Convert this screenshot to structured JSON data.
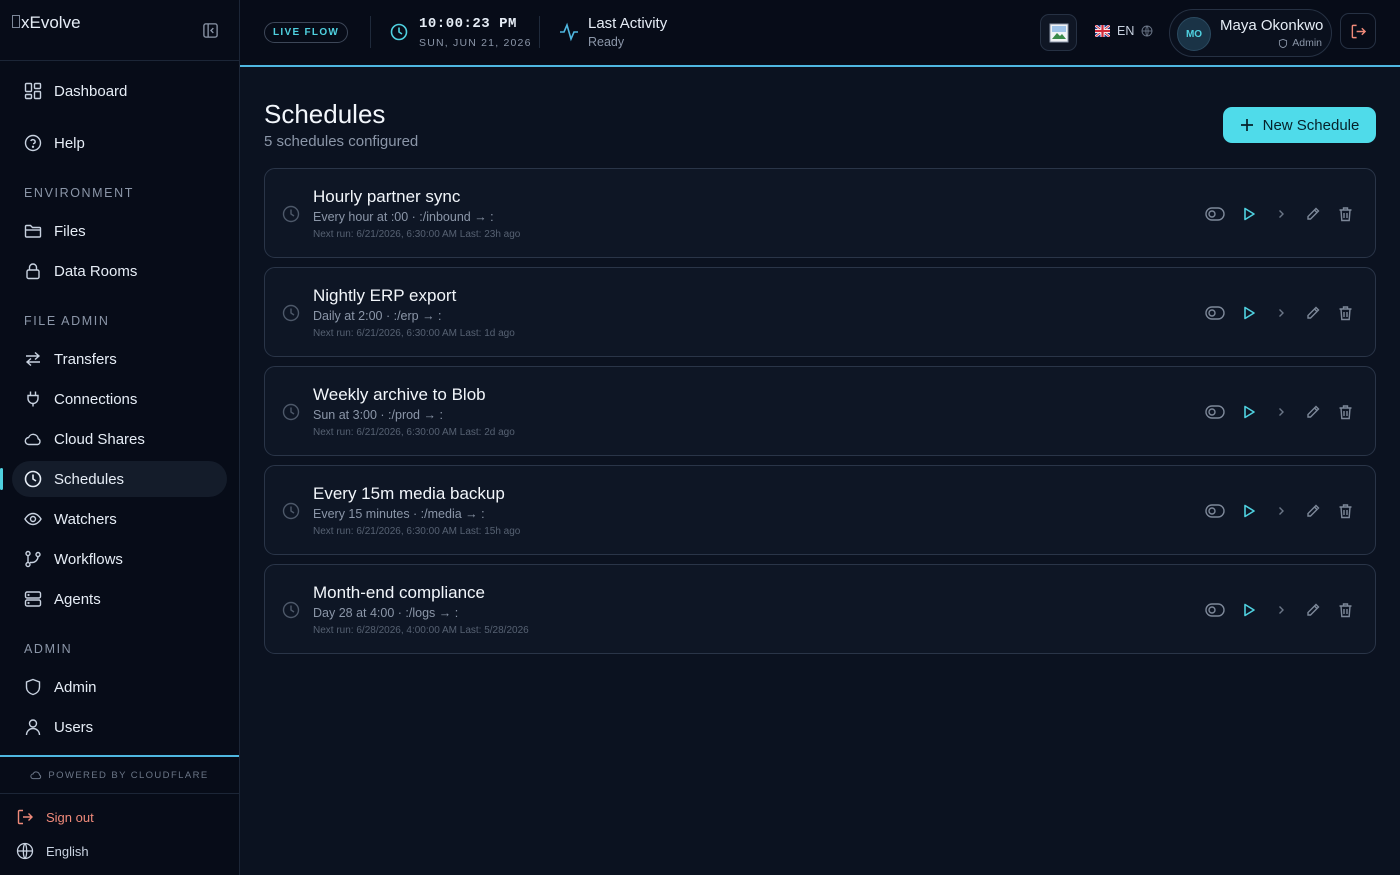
{
  "app": {
    "logo_text": "xEvolve"
  },
  "sidebar": {
    "items": [
      {
        "label": "Dashboard",
        "icon": "dashboard-icon"
      },
      {
        "label": "Help",
        "icon": "help-icon"
      },
      {
        "label": "Files",
        "icon": "folder-icon"
      },
      {
        "label": "Data Rooms",
        "icon": "lock-icon"
      },
      {
        "label": "Transfers",
        "icon": "transfer-arrows-icon"
      },
      {
        "label": "Connections",
        "icon": "plug-icon"
      },
      {
        "label": "Cloud Shares",
        "icon": "cloud-icon"
      },
      {
        "label": "Schedules",
        "icon": "clock-icon",
        "active": true
      },
      {
        "label": "Watchers",
        "icon": "eye-icon"
      },
      {
        "label": "Workflows",
        "icon": "git-branch-icon"
      },
      {
        "label": "Agents",
        "icon": "server-icon"
      },
      {
        "label": "Admin",
        "icon": "shield-icon"
      },
      {
        "label": "Users",
        "icon": "user-icon"
      }
    ],
    "sections": {
      "environment": "ENVIRONMENT",
      "file_admin": "FILE ADMIN",
      "admin": "ADMIN"
    },
    "powered_by": "POWERED BY CLOUDFLARE",
    "sign_out": "Sign out",
    "language": "English"
  },
  "topbar": {
    "live_label": "LIVE FLOW",
    "time": "10:00:23 PM",
    "date": "SUN, JUN 21, 2026",
    "activity_title": "Last Activity",
    "activity_status": "Ready",
    "lang_code": "EN",
    "user": {
      "initials": "MO",
      "name": "Maya Okonkwo",
      "role": "Admin"
    }
  },
  "main": {
    "title": "Schedules",
    "subtitle": "5 schedules configured",
    "new_button": "New Schedule",
    "schedules": [
      {
        "name": "Hourly partner sync",
        "meta": "Every hour at :00 · :/inbound → :",
        "next": "Next run: 6/21/2026, 6:30:00 AM   Last: 23h ago"
      },
      {
        "name": "Nightly ERP export",
        "meta": "Daily at 2:00 · :/erp → :",
        "next": "Next run: 6/21/2026, 6:30:00 AM   Last: 1d ago"
      },
      {
        "name": "Weekly archive to Blob",
        "meta": "Sun at 3:00 · :/prod → :",
        "next": "Next run: 6/21/2026, 6:30:00 AM   Last: 2d ago"
      },
      {
        "name": "Every 15m media backup",
        "meta": "Every 15 minutes · :/media → :",
        "next": "Next run: 6/21/2026, 6:30:00 AM   Last: 15h ago"
      },
      {
        "name": "Month-end compliance",
        "meta": "Day 28 at 4:00 · :/logs → :",
        "next": "Next run: 6/28/2026, 4:00:00 AM   Last: 5/28/2026"
      }
    ]
  },
  "colors": {
    "accent": "#4fdbea",
    "background": "#0b1220",
    "sidebar": "#070c18",
    "danger": "#f08a7a"
  }
}
